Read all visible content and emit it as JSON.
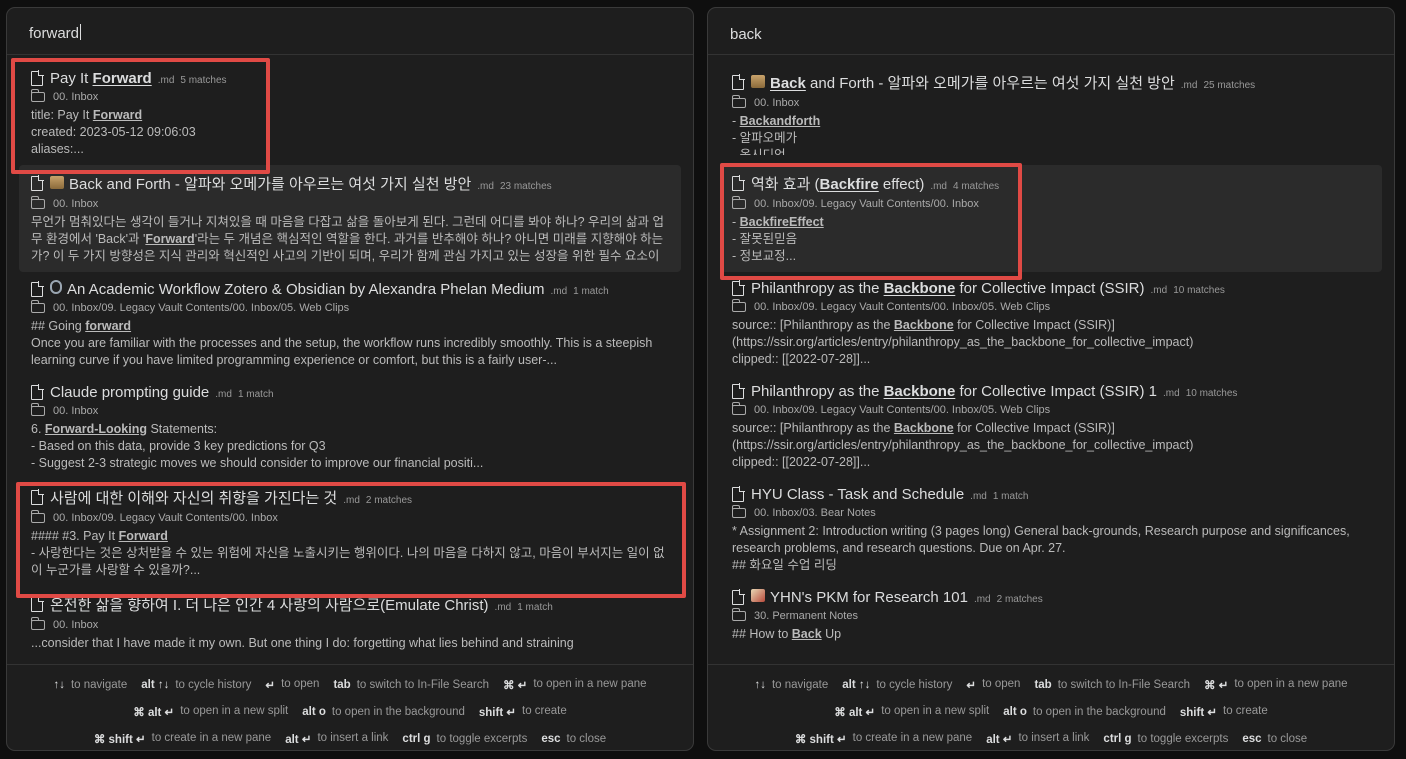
{
  "left": {
    "query": "forward",
    "results": [
      {
        "title_pre": "Pay It ",
        "title_hl": "Forward",
        "title_post": "",
        "ext": ".md",
        "matches": "5 matches",
        "path": "00. Inbox",
        "excerpt": [
          {
            "pre": "title: Pay It ",
            "hl": "Forward",
            "post": ""
          },
          {
            "pre": "created: 2023-05-12 09:06:03",
            "hl": "",
            "post": ""
          },
          {
            "pre": "aliases:...",
            "hl": "",
            "post": ""
          }
        ]
      },
      {
        "title_pre": "Back and Forth - 알파와 오메가를 아우르는 여섯 가지 실천 방안",
        "title_hl": "",
        "title_post": "",
        "ext": ".md",
        "matches": "23 matches",
        "path": "00. Inbox",
        "excerpt": [
          {
            "pre": "무언가 멈춰있다는 생각이 들거나 지쳐있을 때 마음을 다잡고 삶을 돌아보게 된다. 그런데 어디를 봐야 하나? 우리의 삶과 업무 환경에서 'Back'과 '",
            "hl": "Forward",
            "post": "'라는 두 개념은 핵심적인 역할을 한다. 과거를 반추해야 하나? 아니면 미래를 지향해야 하는가? 이 두 가지 방향성은 지식 관리와 혁신적인 사고의 기반이 되며, 우리가 함께 관심 가지고 있는 성장을 위한 필수 요소이다...."
          }
        ]
      },
      {
        "title_pre": "An Academic Workflow Zotero & Obsidian  by Alexandra Phelan  Medium",
        "title_hl": "",
        "title_post": "",
        "ext": ".md",
        "matches": "1 match",
        "path": "00. Inbox/09. Legacy Vault Contents/00. Inbox/05. Web Clips",
        "excerpt": [
          {
            "pre": "## Going ",
            "hl": "forward",
            "post": ""
          },
          {
            "pre": "Once you are familiar with the processes and the setup, the workflow runs incredibly smoothly. This is a steepish learning curve if you have limited programming experience or comfort, but this is a fairly user-...",
            "hl": "",
            "post": ""
          }
        ]
      },
      {
        "title_pre": "Claude prompting guide",
        "title_hl": "",
        "title_post": "",
        "ext": ".md",
        "matches": "1 match",
        "path": "00. Inbox",
        "excerpt": [
          {
            "pre": "6. ",
            "hl": "Forward-Looking",
            "post": " Statements:"
          },
          {
            "pre": "- Based on this data, provide 3 key predictions for Q3",
            "hl": "",
            "post": ""
          },
          {
            "pre": "- Suggest 2-3 strategic moves we should consider to improve our financial positi...",
            "hl": "",
            "post": ""
          }
        ]
      },
      {
        "title_pre": "사람에 대한 이해와 자신의 취향을 가진다는 것",
        "title_hl": "",
        "title_post": "",
        "ext": ".md",
        "matches": "2 matches",
        "path": "00. Inbox/09. Legacy Vault Contents/00. Inbox",
        "excerpt": [
          {
            "pre": "#### #3. Pay It ",
            "hl": "Forward",
            "post": ""
          },
          {
            "pre": "- 사랑한다는 것은 상처받을 수 있는 위험에 자신을 노출시키는 행위이다. 나의 마음을 다하지 않고, 마음이 부서지는 일이 없이 누군가를 사랑할 수 있을까?...",
            "hl": "",
            "post": ""
          }
        ]
      },
      {
        "title_pre": "온전한 삶을 향하여 I. 더 나은 인간 4 사랑의 사람으로(Emulate Christ)",
        "title_hl": "",
        "title_post": "",
        "ext": ".md",
        "matches": "1 match",
        "path": "00. Inbox",
        "excerpt": [
          {
            "pre": "...consider that I have made it my own. But one thing I do: forgetting what lies behind and straining",
            "hl": "",
            "post": ""
          }
        ]
      }
    ]
  },
  "right": {
    "query": "back",
    "results": [
      {
        "title_pre": "",
        "title_hl": "Back",
        "title_post": " and Forth - 알파와 오메가를 아우르는 여섯 가지 실천 방안",
        "ext": ".md",
        "matches": "25 matches",
        "path": "00. Inbox",
        "excerpt": [
          {
            "pre": "- ",
            "hl": "Backandforth",
            "post": ""
          },
          {
            "pre": "- 알파오메가",
            "hl": "",
            "post": ""
          },
          {
            "pre": "- 옵시디언...",
            "hl": "",
            "post": ""
          }
        ]
      },
      {
        "title_pre": "역화 효과 (",
        "title_hl": "Backfire",
        "title_post": " effect)",
        "ext": ".md",
        "matches": "4 matches",
        "path": "00. Inbox/09. Legacy Vault Contents/00. Inbox",
        "excerpt": [
          {
            "pre": "- ",
            "hl": "BackfireEffect",
            "post": ""
          },
          {
            "pre": "- 잘못된믿음",
            "hl": "",
            "post": ""
          },
          {
            "pre": "- 정보교정...",
            "hl": "",
            "post": ""
          }
        ]
      },
      {
        "title_pre": "Philanthropy as the ",
        "title_hl": "Backbone",
        "title_post": " for Collective Impact (SSIR)",
        "ext": ".md",
        "matches": "10 matches",
        "path": "00. Inbox/09. Legacy Vault Contents/00. Inbox/05. Web Clips",
        "excerpt": [
          {
            "pre": "source:: [Philanthropy as the ",
            "hl": "Backbone",
            "post": " for Collective Impact (SSIR)]"
          },
          {
            "pre": "(https://ssir.org/articles/entry/philanthropy_as_the_backbone_for_collective_impact)",
            "hl": "",
            "post": ""
          },
          {
            "pre": "clipped:: [[2022-07-28]]...",
            "hl": "",
            "post": ""
          }
        ]
      },
      {
        "title_pre": "Philanthropy as the ",
        "title_hl": "Backbone",
        "title_post": " for Collective Impact (SSIR) 1",
        "ext": ".md",
        "matches": "10 matches",
        "path": "00. Inbox/09. Legacy Vault Contents/00. Inbox/05. Web Clips",
        "excerpt": [
          {
            "pre": "source:: [Philanthropy as the ",
            "hl": "Backbone",
            "post": " for Collective Impact (SSIR)]"
          },
          {
            "pre": "(https://ssir.org/articles/entry/philanthropy_as_the_backbone_for_collective_impact)",
            "hl": "",
            "post": ""
          },
          {
            "pre": "clipped:: [[2022-07-28]]...",
            "hl": "",
            "post": ""
          }
        ]
      },
      {
        "title_pre": "HYU Class - Task and Schedule",
        "title_hl": "",
        "title_post": "",
        "ext": ".md",
        "matches": "1 match",
        "path": "00. Inbox/03. Bear Notes",
        "excerpt": [
          {
            "pre": "* Assignment 2: Introduction writing (3 pages long) General back-grounds, Research purpose and significances, research problems, and research questions. Due on Apr. 27.",
            "hl": "",
            "post": ""
          },
          {
            "pre": "## 화요일 수업 리딩",
            "hl": "",
            "post": ""
          }
        ]
      },
      {
        "title_pre": "YHN's PKM for Research 101",
        "title_hl": "",
        "title_post": "",
        "ext": ".md",
        "matches": "2 matches",
        "path": "30. Permanent Notes",
        "excerpt": [
          {
            "pre": "## How to ",
            "hl": "Back",
            "post": " Up"
          }
        ]
      }
    ]
  },
  "footer": {
    "line1": [
      {
        "key": "↑↓",
        "action": "to navigate"
      },
      {
        "key": "alt ↑↓",
        "action": "to cycle history"
      },
      {
        "key": "↵",
        "action": "to open"
      },
      {
        "key": "tab",
        "action": "to switch to In-File Search"
      },
      {
        "key": "⌘ ↵",
        "action": "to open in a new pane"
      }
    ],
    "line2": [
      {
        "key": "⌘ alt ↵",
        "action": "to open in a new split"
      },
      {
        "key": "alt o",
        "action": "to open in the background"
      },
      {
        "key": "shift ↵",
        "action": "to create"
      }
    ],
    "line3": [
      {
        "key": "⌘ shift ↵",
        "action": "to create in a new pane"
      },
      {
        "key": "alt ↵",
        "action": "to insert a link"
      },
      {
        "key": "ctrl g",
        "action": "to toggle excerpts"
      },
      {
        "key": "esc",
        "action": "to close"
      }
    ]
  },
  "colors": {
    "highlight_box": "#e04a45",
    "panel_bg": "#1e1e1e",
    "selected_bg": "#2b2b2b"
  }
}
